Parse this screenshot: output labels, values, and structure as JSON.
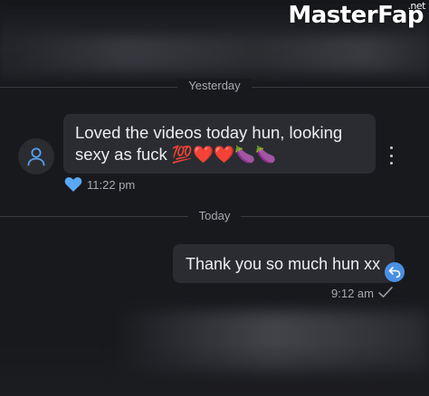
{
  "watermark": {
    "brand": "MasterFap",
    "suffix": ".net"
  },
  "dividers": {
    "yesterday": "Yesterday",
    "today": "Today"
  },
  "incoming": {
    "text": "Loved the videos today hun, looking sexy as fuck 💯❤️❤️🍆🍆",
    "time": "11:22 pm",
    "avatar_icon": "user-icon",
    "reaction_icon": "heart-icon",
    "menu_icon": "more-vertical-icon"
  },
  "outgoing": {
    "text": "Thank you so much hun xx",
    "time": "9:12 am",
    "status_icon": "check-icon",
    "reply_icon": "reply-icon"
  },
  "colors": {
    "background": "#18191d",
    "bubble": "#2a2c31",
    "accent": "#4a90e2",
    "muted_text": "#a8aab0"
  }
}
